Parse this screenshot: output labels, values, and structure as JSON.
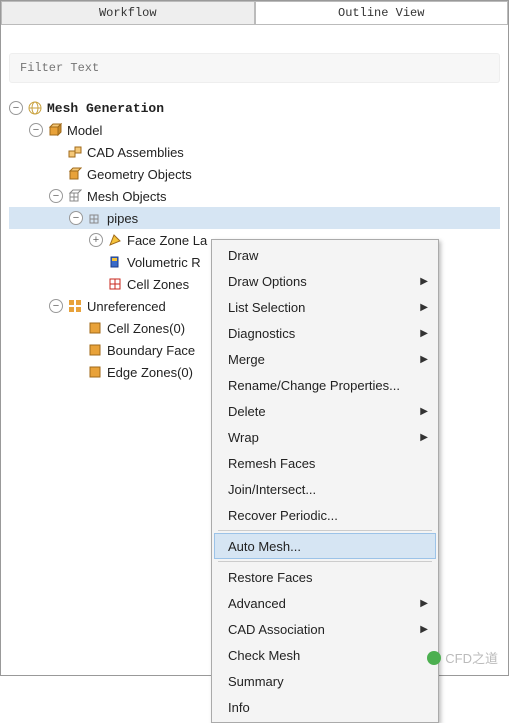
{
  "tabs": {
    "workflow": "Workflow",
    "outline": "Outline View"
  },
  "filter": {
    "placeholder": "Filter Text"
  },
  "tree": {
    "root": "Mesh Generation",
    "model": "Model",
    "cad": "CAD Assemblies",
    "geom": "Geometry Objects",
    "meshobj": "Mesh Objects",
    "pipes": "pipes",
    "face": "Face Zone La",
    "vol": "Volumetric R",
    "cellz": "Cell Zones",
    "unref": "Unreferenced",
    "cellz0": "Cell Zones(0)",
    "bface": "Boundary Face",
    "edgez": "Edge Zones(0)"
  },
  "menu": {
    "draw": "Draw",
    "drawopt": "Draw Options",
    "listsel": "List Selection",
    "diag": "Diagnostics",
    "merge": "Merge",
    "rename": "Rename/Change Properties...",
    "delete": "Delete",
    "wrap": "Wrap",
    "remesh": "Remesh Faces",
    "join": "Join/Intersect...",
    "recover": "Recover Periodic...",
    "automesh": "Auto Mesh...",
    "restore": "Restore Faces",
    "advanced": "Advanced",
    "cad": "CAD Association",
    "check": "Check Mesh",
    "summary": "Summary",
    "info": "Info"
  },
  "watermark": "CFD之道"
}
